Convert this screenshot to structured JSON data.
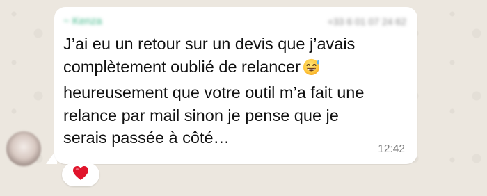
{
  "message": {
    "sender_name": "~ Kenza",
    "sender_phone": "+33 6 01 07 24 62",
    "lines": [
      "J’ai eu un retour sur un devis que j’avais",
      "complètement oublié de relancer",
      "heureusement que votre outil m’a fait une",
      "relance par mail sinon je pense que je",
      "serais passée à côté…"
    ],
    "inline_emoji": "grinning-sweat-icon",
    "time": "12:42"
  },
  "reactions": [
    {
      "icon": "red-heart-icon"
    }
  ],
  "colors": {
    "background": "#ece7df",
    "bubble": "#ffffff",
    "sender_name": "#41b889",
    "text": "#111111",
    "timestamp": "#7d7d7d",
    "heart": "#e0142b"
  }
}
